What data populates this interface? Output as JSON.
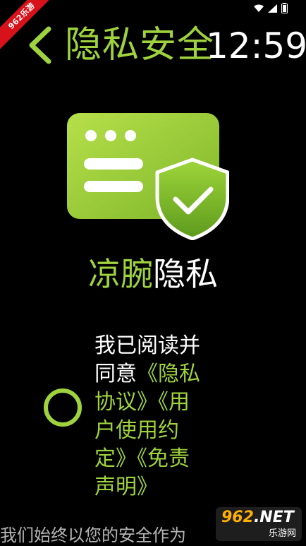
{
  "status_bar": {
    "icons": [
      "wifi-icon",
      "signal-icon",
      "battery-icon"
    ]
  },
  "watermark": {
    "ribbon": "962乐游",
    "badge_logo_num": "962",
    "badge_logo_net": ".NET",
    "badge_sub": "乐游网"
  },
  "header": {
    "back_icon": "chevron-left-icon",
    "title": "隐私安全",
    "clock": "12:59"
  },
  "brand": {
    "app_name": "凉腕",
    "suffix": "隐私"
  },
  "agreement": {
    "prefix": "我已阅读并同意",
    "privacy_link": "《隐私协议》",
    "user_agreement_link": "《用户使用约定》",
    "disclaimer_link": "《免责声明》"
  },
  "footer": {
    "text": "我们始终以您的安全作为"
  },
  "colors": {
    "accent": "#9fd33e",
    "background": "#000000",
    "text": "#ffffff"
  }
}
